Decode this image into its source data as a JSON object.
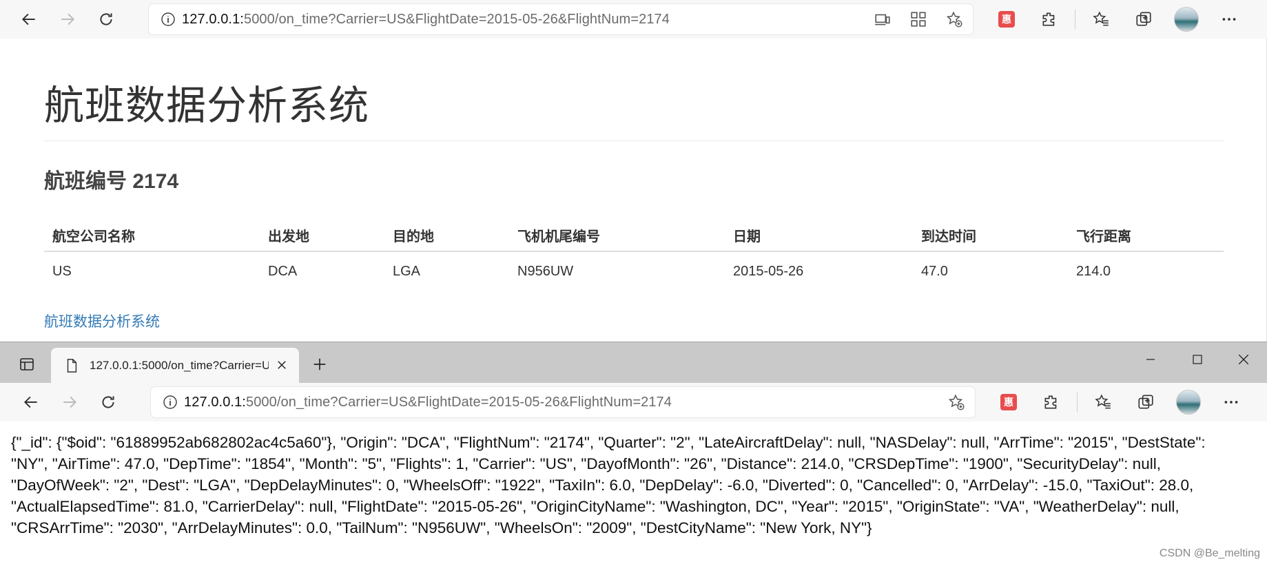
{
  "top_browser": {
    "url_host": "127.0.0.1:",
    "url_rest": "5000/on_time?Carrier=US&FlightDate=2015-05-26&FlightNum=2174",
    "ext_badge": "惠"
  },
  "page": {
    "title": "航班数据分析系统",
    "subtitle": "航班编号 2174",
    "table": {
      "headers": [
        "航空公司名称",
        "出发地",
        "目的地",
        "飞机机尾编号",
        "日期",
        "到达时间",
        "飞行距离"
      ],
      "rows": [
        [
          "US",
          "DCA",
          "LGA",
          "N956UW",
          "2015-05-26",
          "47.0",
          "214.0"
        ]
      ]
    },
    "footer_link": "航班数据分析系统"
  },
  "second_window": {
    "tab_title": "127.0.0.1:5000/on_time?Carrier=U",
    "url_host": "127.0.0.1:",
    "url_rest": "5000/on_time?Carrier=US&FlightDate=2015-05-26&FlightNum=2174",
    "ext_badge": "惠",
    "json_text": "{\"_id\": {\"$oid\": \"61889952ab682802ac4c5a60\"}, \"Origin\": \"DCA\", \"FlightNum\": \"2174\", \"Quarter\": \"2\", \"LateAircraftDelay\": null, \"NASDelay\": null, \"ArrTime\": \"2015\", \"DestState\": \"NY\", \"AirTime\": 47.0, \"DepTime\": \"1854\", \"Month\": \"5\", \"Flights\": 1, \"Carrier\": \"US\", \"DayofMonth\": \"26\", \"Distance\": 214.0, \"CRSDepTime\": \"1900\", \"SecurityDelay\": null, \"DayOfWeek\": \"2\", \"Dest\": \"LGA\", \"DepDelayMinutes\": 0, \"WheelsOff\": \"1922\", \"TaxiIn\": 6.0, \"DepDelay\": -6.0, \"Diverted\": 0, \"Cancelled\": 0, \"ArrDelay\": -15.0, \"TaxiOut\": 28.0, \"ActualElapsedTime\": 81.0, \"CarrierDelay\": null, \"FlightDate\": \"2015-05-26\", \"OriginCityName\": \"Washington, DC\", \"Year\": \"2015\", \"OriginState\": \"VA\", \"WeatherDelay\": null, \"CRSArrTime\": \"2030\", \"ArrDelayMinutes\": 0.0, \"TailNum\": \"N956UW\", \"WheelsOn\": \"2009\", \"DestCityName\": \"New York, NY\"}"
  },
  "watermark": "CSDN @Be_melting",
  "colors": {
    "link": "#337ab7",
    "toolbar_bg": "#f7f7f7",
    "tabbar_bg": "#c9c9c9",
    "badge_red": "#e84d4d"
  },
  "icons": [
    "back-arrow-icon",
    "forward-arrow-icon",
    "refresh-icon",
    "info-icon",
    "device-icon",
    "qr-icon",
    "add-favorite-icon",
    "extension-puzzle-icon",
    "favorites-icon",
    "collections-icon",
    "more-icon",
    "tab-actions-icon",
    "page-icon",
    "close-icon",
    "plus-icon",
    "minimize-icon",
    "maximize-icon"
  ]
}
